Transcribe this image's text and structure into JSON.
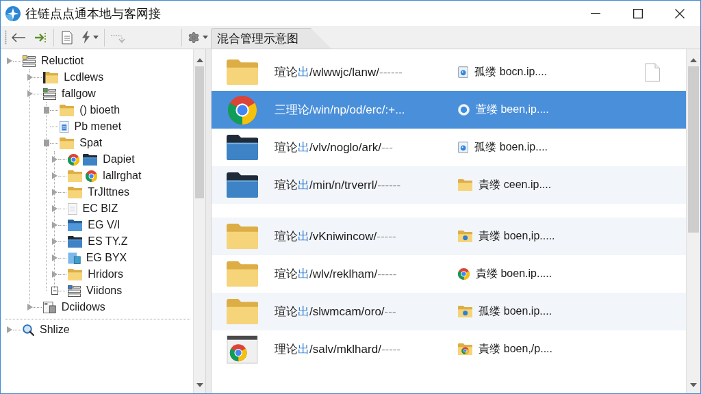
{
  "window": {
    "title": "往链点点通本地与客网接"
  },
  "toolbar": {
    "groups": [
      {
        "buttons": [
          {
            "kind": "back",
            "disabled": false
          },
          {
            "kind": "forward",
            "disabled": false
          }
        ]
      },
      {
        "buttons": [
          {
            "kind": "document",
            "disabled": false
          },
          {
            "kind": "lightning",
            "disabled": false
          }
        ]
      },
      {
        "buttons": [
          {
            "kind": "hook-arrow",
            "disabled": true
          }
        ]
      },
      {
        "buttons": [
          {
            "kind": "gear",
            "disabled": false
          }
        ]
      }
    ]
  },
  "tabs": [
    {
      "label": "混合管理示意图",
      "selected": true
    }
  ],
  "tree": {
    "roots": [
      {
        "label": "Reluctiot",
        "children": [
          {
            "label": "Lcdlews"
          },
          {
            "label": "fallgow",
            "children": [
              {
                "label": "() bioeth"
              },
              {
                "label": "Pb menet"
              },
              {
                "label": "Spat",
                "children": [
                  {
                    "label": "Dapiet"
                  },
                  {
                    "label": "lallrghat"
                  },
                  {
                    "label": "TrJlttnes"
                  },
                  {
                    "label": "EC BIZ"
                  },
                  {
                    "label": "EG V/I"
                  },
                  {
                    "label": "ES TY.Z"
                  },
                  {
                    "label": "EG BYX"
                  },
                  {
                    "label": "Hridors"
                  },
                  {
                    "label": "Viidons"
                  }
                ]
              }
            ]
          },
          {
            "label": "Dciidows"
          }
        ]
      },
      {
        "label": "Shlize"
      }
    ]
  },
  "list": {
    "groups": [
      {
        "rows": [
          {
            "name": [
              {
                "text": "瑄论",
                "kind": "plain"
              },
              {
                "text": "出",
                "kind": "accent"
              },
              {
                "text": "/wlwwjc/lanw/",
                "kind": "plain"
              },
              {
                "text": "------",
                "kind": "faint"
              }
            ],
            "host": "孤缕 bocn.ip....",
            "selected": false,
            "shaded": false
          },
          {
            "name": [
              {
                "text": "三理论/win/np/od/erc/:+...",
                "kind": "plain"
              }
            ],
            "host": "萱缕 been,ip....",
            "selected": true
          },
          {
            "name": [
              {
                "text": "瑄论",
                "kind": "plain"
              },
              {
                "text": "出",
                "kind": "accent"
              },
              {
                "text": "/vlv/noglo/ark/",
                "kind": "plain"
              },
              {
                "text": "---",
                "kind": "faint"
              }
            ],
            "host": "孤缕 boen.ip....",
            "selected": false,
            "shaded": false
          },
          {
            "name": [
              {
                "text": "瑄论",
                "kind": "plain"
              },
              {
                "text": "出",
                "kind": "accent"
              },
              {
                "text": "/min/n/trverrl/",
                "kind": "plain"
              },
              {
                "text": "------",
                "kind": "faint"
              }
            ],
            "host": "責缕 ceen.ip....",
            "selected": false,
            "shaded": true
          }
        ]
      },
      {
        "rows": [
          {
            "name": [
              {
                "text": "瑄论",
                "kind": "plain"
              },
              {
                "text": "出",
                "kind": "accent"
              },
              {
                "text": "/vKniwincow/",
                "kind": "plain"
              },
              {
                "text": "-----",
                "kind": "faint"
              }
            ],
            "host": "責缕 boen,ip.....",
            "selected": false,
            "shaded": true
          },
          {
            "name": [
              {
                "text": "瑄论",
                "kind": "plain"
              },
              {
                "text": "出",
                "kind": "accent"
              },
              {
                "text": "/wlv/reklham/",
                "kind": "plain"
              },
              {
                "text": "-----",
                "kind": "faint"
              }
            ],
            "host": "責缕 boen.ip.....",
            "selected": false,
            "shaded": false
          },
          {
            "name": [
              {
                "text": "瑄论",
                "kind": "plain"
              },
              {
                "text": "出",
                "kind": "accent"
              },
              {
                "text": "/slwmcam/oro/",
                "kind": "plain"
              },
              {
                "text": "---",
                "kind": "faint"
              }
            ],
            "host": "孤缕 boen.ip....",
            "selected": false,
            "shaded": true
          },
          {
            "name": [
              {
                "text": "理论",
                "kind": "plain"
              },
              {
                "text": "出",
                "kind": "accent"
              },
              {
                "text": "/salv/mklhard/",
                "kind": "plain"
              },
              {
                "text": "-----",
                "kind": "faint"
              }
            ],
            "host": "責缕 boen,/p....",
            "selected": false,
            "shaded": false
          }
        ]
      }
    ]
  }
}
